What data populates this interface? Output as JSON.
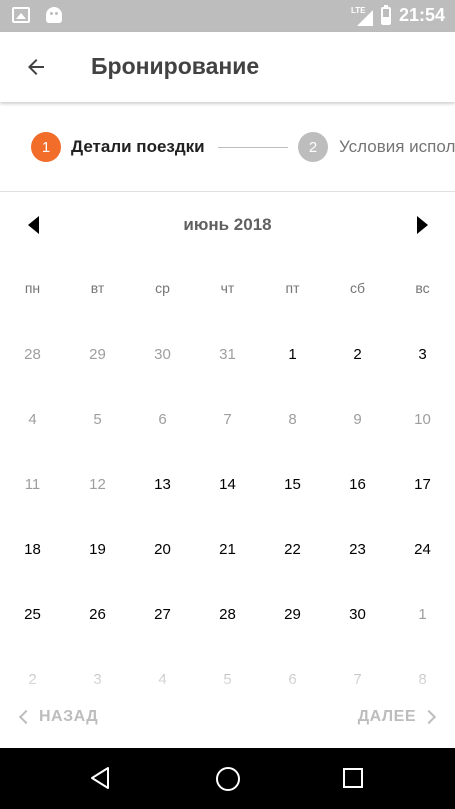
{
  "status_bar": {
    "time": "21:54",
    "network_label": "LTE",
    "icons": [
      "image-icon",
      "android-icon",
      "signal-icon",
      "battery-icon"
    ]
  },
  "app_bar": {
    "title": "Бронирование",
    "back_icon": "arrow-back-icon"
  },
  "stepper": {
    "steps": [
      {
        "number": "1",
        "label": "Детали поездки",
        "active": true
      },
      {
        "number": "2",
        "label": "Условия испол",
        "active": false
      }
    ],
    "active_color": "#f26c2a",
    "inactive_color": "#bdbdbd"
  },
  "calendar": {
    "month_label": "июнь 2018",
    "weekdays": [
      "пн",
      "вт",
      "ср",
      "чт",
      "пт",
      "сб",
      "вс"
    ],
    "weeks": [
      [
        "28",
        "29",
        "30",
        "31",
        "1",
        "2",
        "3"
      ],
      [
        "4",
        "5",
        "6",
        "7",
        "8",
        "9",
        "10"
      ],
      [
        "11",
        "12",
        "13",
        "14",
        "15",
        "16",
        "17"
      ],
      [
        "18",
        "19",
        "20",
        "21",
        "22",
        "23",
        "24"
      ],
      [
        "25",
        "26",
        "27",
        "28",
        "29",
        "30",
        "1"
      ],
      [
        "2",
        "3",
        "4",
        "5",
        "6",
        "7",
        "8"
      ]
    ],
    "day_states": [
      [
        "out",
        "out",
        "out",
        "out",
        "in",
        "in",
        "in"
      ],
      [
        "out",
        "out",
        "out",
        "out",
        "out",
        "out",
        "out"
      ],
      [
        "out",
        "out",
        "in",
        "in",
        "in",
        "in",
        "in"
      ],
      [
        "in",
        "in",
        "in",
        "in",
        "in",
        "in",
        "in"
      ],
      [
        "in",
        "in",
        "in",
        "in",
        "in",
        "in",
        "out"
      ],
      [
        "out",
        "out",
        "out",
        "out",
        "out",
        "out",
        "out"
      ]
    ]
  },
  "footer": {
    "back_label": "НАЗАД",
    "next_label": "ДАЛЕЕ"
  }
}
